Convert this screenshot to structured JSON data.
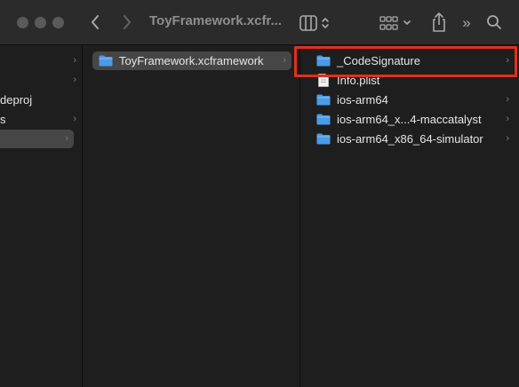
{
  "window": {
    "title": "ToyFramework.xcfr..."
  },
  "toolbar": {
    "back_icon": "chevron-left",
    "forward_icon": "chevron-right",
    "view_icon": "column-view",
    "group_icon": "grid-group",
    "share_icon": "share",
    "more_label": "»",
    "search_icon": "magnifying-glass"
  },
  "column1": {
    "items": [
      {
        "label": ""
      },
      {
        "label": ""
      },
      {
        "label": "deproj"
      },
      {
        "label": "s"
      },
      {
        "label": ""
      }
    ]
  },
  "column2": {
    "items": [
      {
        "label": "ToyFramework.xcframework",
        "kind": "folder",
        "selected": true
      }
    ]
  },
  "column3": {
    "items": [
      {
        "label": "_CodeSignature",
        "kind": "folder"
      },
      {
        "label": "Info.plist",
        "kind": "file"
      },
      {
        "label": "ios-arm64",
        "kind": "folder"
      },
      {
        "label": "ios-arm64_x...4-maccatalyst",
        "kind": "folder"
      },
      {
        "label": "ios-arm64_x86_64-simulator",
        "kind": "folder"
      }
    ]
  },
  "colors": {
    "folder_blue": "#4a9be8",
    "selection": "#464646",
    "highlight_box": "#e0301e"
  }
}
